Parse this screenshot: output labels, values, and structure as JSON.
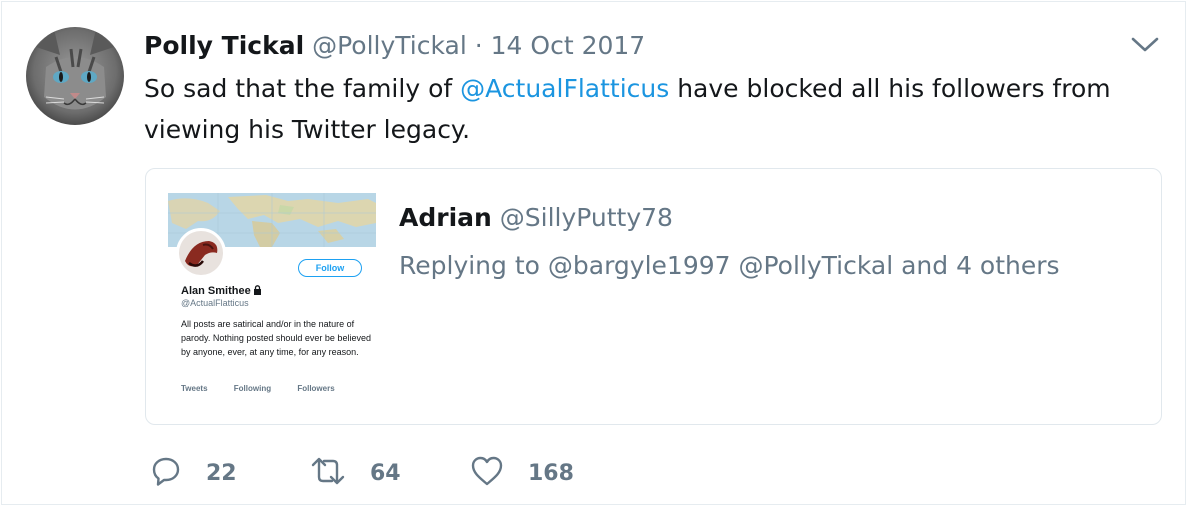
{
  "tweet": {
    "author_name": "Polly Tickal",
    "author_handle": "@PollyTickal",
    "separator": "·",
    "date": "14 Oct 2017",
    "text_before": "So sad that the family of ",
    "mention": "@ActualFlatticus",
    "text_after": " have blocked all his followers from viewing his Twitter legacy."
  },
  "quoted": {
    "author_name": "Adrian",
    "author_handle": "@SillyPutty78",
    "reply_text": "Replying to @bargyle1997 @PollyTickal and 4 others",
    "profile_card": {
      "name": "Alan Smithee",
      "handle": "@ActualFlatticus",
      "follow_label": "Follow",
      "bio": "All posts are satirical and/or in the nature of parody. Nothing posted should ever be believed by anyone, ever, at any time, for any reason.",
      "stat_tweets": "Tweets",
      "stat_following": "Following",
      "stat_followers": "Followers"
    }
  },
  "actions": {
    "replies": "22",
    "retweets": "64",
    "likes": "168"
  },
  "icons": {
    "menu": "chevron-down-icon",
    "reply": "reply-icon",
    "retweet": "retweet-icon",
    "like": "heart-icon",
    "lock": "lock-icon"
  },
  "colors": {
    "link": "#1b95e0",
    "muted": "#657786",
    "text": "#14171a",
    "border": "#e1e8ed"
  }
}
